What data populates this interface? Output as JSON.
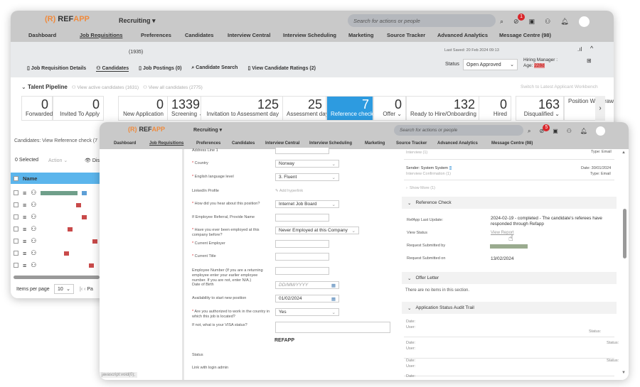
{
  "app": {
    "logo_ref": "REF",
    "logo_app": "APP",
    "module": "Recruiting",
    "search_placeholder": "Search for actions or people",
    "notification_count": "1",
    "front_notification_count": "5"
  },
  "nav": [
    "Dashboard",
    "Job Requisitions",
    "Preferences",
    "Candidates",
    "Interview Central",
    "Interview Scheduling",
    "Marketing",
    "Source Tracker",
    "Advanced Analytics",
    "Message Centre (98)"
  ],
  "requisition": {
    "count": "(1935)",
    "last_saved": "Last Saved: 20 Feb 2024 09:13",
    "status_label": "Status",
    "status_value": "Open Approved",
    "hiring_manager": "Hiring Manager :",
    "age_label": "Age:",
    "age_value": "228d"
  },
  "subtabs": [
    "Job Requisition Details",
    "Candidates",
    "Job Postings (0)",
    "Candidate Search",
    "View Candidate Ratings (2)"
  ],
  "pipeline": {
    "title": "Talent Pipeline",
    "active_link": "View active candidates (1631)",
    "all_link": "View all candidates (2775)",
    "switch_link": "Switch to Latest Applicant Workbench",
    "stages": [
      {
        "count": "0",
        "label": "Forwarded"
      },
      {
        "count": "0",
        "label": "Invited To Apply"
      },
      {
        "count": "0",
        "label": "New Application"
      },
      {
        "count": "1339",
        "label": "Screening"
      },
      {
        "count": "125",
        "label": "Invitation to Assessment day"
      },
      {
        "count": "25",
        "label": "Assessment day"
      },
      {
        "count": "7",
        "label": "Reference check"
      },
      {
        "count": "0",
        "label": "Offer"
      },
      {
        "count": "132",
        "label": "Ready to Hire/Onboarding"
      },
      {
        "count": "0",
        "label": "Hired"
      },
      {
        "count": "163",
        "label": "Disqualified"
      },
      {
        "count": "",
        "label": "Position Withdrawn"
      }
    ]
  },
  "candidates": {
    "breadcrumb": "Candidates: View Reference check (7",
    "selected": "0 Selected",
    "action": "Action",
    "display": "Dis",
    "name_header": "Name",
    "items_per_page_label": "Items per page",
    "items_per_page": "10",
    "page_label": "Pa"
  },
  "form": {
    "address": "Address Line 1",
    "fields": [
      {
        "label": "Country",
        "required": true,
        "value": "Norway"
      },
      {
        "label": "English language level",
        "required": true,
        "value": "3. Fluent"
      },
      {
        "label": "LinkedIn Profile",
        "required": false,
        "value": "Add hyperlink"
      },
      {
        "label": "How did you hear about this position?",
        "required": true,
        "value": "Internet Job Board"
      },
      {
        "label": "If Employee Referral, Provide Name",
        "required": false,
        "value": ""
      },
      {
        "label": "Have you ever been employed at this company before?",
        "required": true,
        "value": "Never Employed at this Company"
      },
      {
        "label": "Current Employer",
        "required": true,
        "value": ""
      },
      {
        "label": "Current Title",
        "required": true,
        "value": ""
      },
      {
        "label": "Employee Number (If you are a returning employee enter your earlier employee number. If you are not, enter N/A.)",
        "required": false,
        "value": ""
      },
      {
        "label": "Date of Birth",
        "required": false,
        "value": "DD/MM/YYYY"
      },
      {
        "label": "Availability to start new position",
        "required": false,
        "value": "01/02/2024"
      },
      {
        "label": "Are you authorized to work in the country in which this job is located?",
        "required": true,
        "value": "Yes"
      },
      {
        "label": "If not, what is your VISA status?",
        "required": false,
        "value": ""
      }
    ],
    "section_title": "REFAPP",
    "status": "Status",
    "link_login": "Link with login admin",
    "status_bar": "javascript:void(0);"
  },
  "messages": {
    "item1_sub": "Interview (1)",
    "item1_type": "Type: Email",
    "item2_sender": "Sender: System System",
    "item2_sub": "Interview Confirmation (1)",
    "item2_date": "Date: 30/01/2024",
    "item2_type": "Type: Email",
    "show_more": "Show More (1)"
  },
  "reference_check": {
    "title": "Reference Check",
    "last_update_label": "RefApp Last Update:",
    "last_update": "2024-02-19 - completed - The candidate's referees have responded through Refapp",
    "view_status_label": "View Status",
    "view_report": "View Report",
    "submitted_by_label": "Request Submitted by",
    "submitted_on_label": "Request Submitted on",
    "submitted_on": "13/02/2024"
  },
  "offer_letter": {
    "title": "Offer Letter",
    "empty": "There are no items in this section."
  },
  "audit": {
    "title": "Application Status Audit Trail",
    "date": "Date:",
    "user": "User:",
    "status": "Status:"
  }
}
